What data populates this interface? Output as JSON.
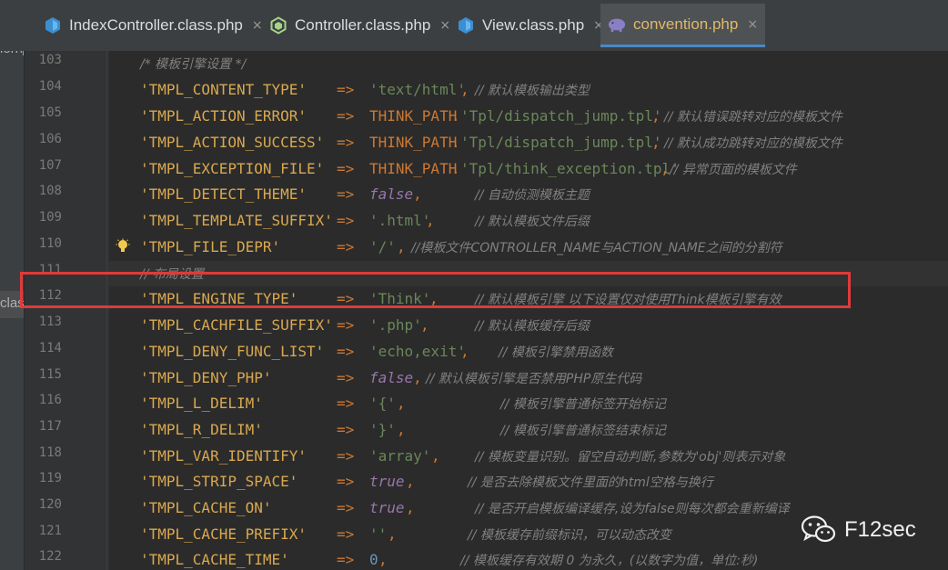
{
  "tabs": [
    {
      "label": "IndexController.class.php",
      "icon": "php-class-icon",
      "active": false
    },
    {
      "label": "Controller.class.php",
      "icon": "php-interface-icon",
      "active": false
    },
    {
      "label": "View.class.php",
      "icon": "php-class-icon",
      "active": false
    },
    {
      "label": "convention.php",
      "icon": "php-file-icon",
      "active": true
    }
  ],
  "close_glyph": "×",
  "project_strip": {
    "text_top": "ion\\p",
    "text_selected": "class"
  },
  "lines": {
    "l103": {
      "num": "103",
      "comment": "/* 模板引擎设置 */"
    },
    "l104": {
      "num": "104",
      "key": "'TMPL_CONTENT_TYPE'",
      "arrow": "=>",
      "val": "'text/html'",
      "sep": ",",
      "comment": "// 默认模板输出类型"
    },
    "l105": {
      "num": "105",
      "key": "'TMPL_ACTION_ERROR'",
      "arrow": "=>",
      "const": "THINK_PATH",
      "dot": ".",
      "val": "'Tpl/dispatch_jump.tpl'",
      "sep": ",",
      "comment": "// 默认错误跳转对应的模板文件"
    },
    "l106": {
      "num": "106",
      "key": "'TMPL_ACTION_SUCCESS'",
      "arrow": "=>",
      "const": "THINK_PATH",
      "dot": ".",
      "val": "'Tpl/dispatch_jump.tpl'",
      "sep": ",",
      "comment": "// 默认成功跳转对应的模板文件"
    },
    "l107": {
      "num": "107",
      "key": "'TMPL_EXCEPTION_FILE'",
      "arrow": "=>",
      "const": "THINK_PATH",
      "dot": ".",
      "val": "'Tpl/think_exception.tpl'",
      "sep": ",",
      "comment": "// 异常页面的模板文件"
    },
    "l108": {
      "num": "108",
      "key": "'TMPL_DETECT_THEME'",
      "arrow": "=>",
      "val": "false",
      "sep": ",",
      "comment": "// 自动侦测模板主题"
    },
    "l109": {
      "num": "109",
      "key": "'TMPL_TEMPLATE_SUFFIX'",
      "arrow": "=>",
      "val": "'.html'",
      "sep": ",",
      "comment": "// 默认模板文件后缀"
    },
    "l110": {
      "num": "110",
      "key": "'TMPL_FILE_DEPR'",
      "arrow": "=>",
      "val": "'/'",
      "sep": ",",
      "comment": "//模板文件CONTROLLER_NAME与ACTION_NAME之间的分割符"
    },
    "l111": {
      "num": "111",
      "comment": "// 布局设置"
    },
    "l112": {
      "num": "112",
      "key": "'TMPL_ENGINE_TYPE'",
      "arrow": "=>",
      "val": "'Think'",
      "sep": ",",
      "comment": "// 默认模板引擎 以下设置仅对使用Think模板引擎有效"
    },
    "l113": {
      "num": "113",
      "key": "'TMPL_CACHFILE_SUFFIX'",
      "arrow": "=>",
      "val": "'.php'",
      "sep": ",",
      "comment": "// 默认模板缓存后缀"
    },
    "l114": {
      "num": "114",
      "key": "'TMPL_DENY_FUNC_LIST'",
      "arrow": "=>",
      "val": "'echo,exit'",
      "sep": ",",
      "comment": "// 模板引擎禁用函数"
    },
    "l115": {
      "num": "115",
      "key": "'TMPL_DENY_PHP'",
      "arrow": "=>",
      "val": "false",
      "sep": ",",
      "comment": "// 默认模板引擎是否禁用PHP原生代码"
    },
    "l116": {
      "num": "116",
      "key": "'TMPL_L_DELIM'",
      "arrow": "=>",
      "val": "'{'",
      "sep": ",",
      "comment": "// 模板引擎普通标签开始标记"
    },
    "l117": {
      "num": "117",
      "key": "'TMPL_R_DELIM'",
      "arrow": "=>",
      "val": "'}'",
      "sep": ",",
      "comment": "// 模板引擎普通标签结束标记"
    },
    "l118": {
      "num": "118",
      "key": "'TMPL_VAR_IDENTIFY'",
      "arrow": "=>",
      "val": "'array'",
      "sep": ",",
      "comment": "// 模板变量识别。留空自动判断,参数为'obj'则表示对象"
    },
    "l119": {
      "num": "119",
      "key": "'TMPL_STRIP_SPACE'",
      "arrow": "=>",
      "val": "true",
      "sep": ",",
      "comment": "// 是否去除模板文件里面的html空格与换行"
    },
    "l120": {
      "num": "120",
      "key": "'TMPL_CACHE_ON'",
      "arrow": "=>",
      "val": "true",
      "sep": ",",
      "comment": "// 是否开启模板编译缓存,设为false则每次都会重新编译"
    },
    "l121": {
      "num": "121",
      "key": "'TMPL_CACHE_PREFIX'",
      "arrow": "=>",
      "val": "''",
      "sep": ",",
      "comment": "// 模板缓存前缀标识，可以动态改变"
    },
    "l122": {
      "num": "122",
      "key": "'TMPL_CACHE_TIME'",
      "arrow": "=>",
      "val": "0",
      "sep": ",",
      "comment": "// 模板缓存有效期 0 为永久，(以数字为值，单位:秒)"
    }
  },
  "watermark": {
    "icon": "wechat-icon",
    "text": "F12sec"
  },
  "colors": {
    "key": "#d9a84f",
    "operator": "#cc7832",
    "string": "#6a8759",
    "constant": "#9876aa",
    "number": "#6897bb",
    "comment": "#808080",
    "highlight_box": "#e03a3a",
    "active_tab": "#e0b86b"
  }
}
